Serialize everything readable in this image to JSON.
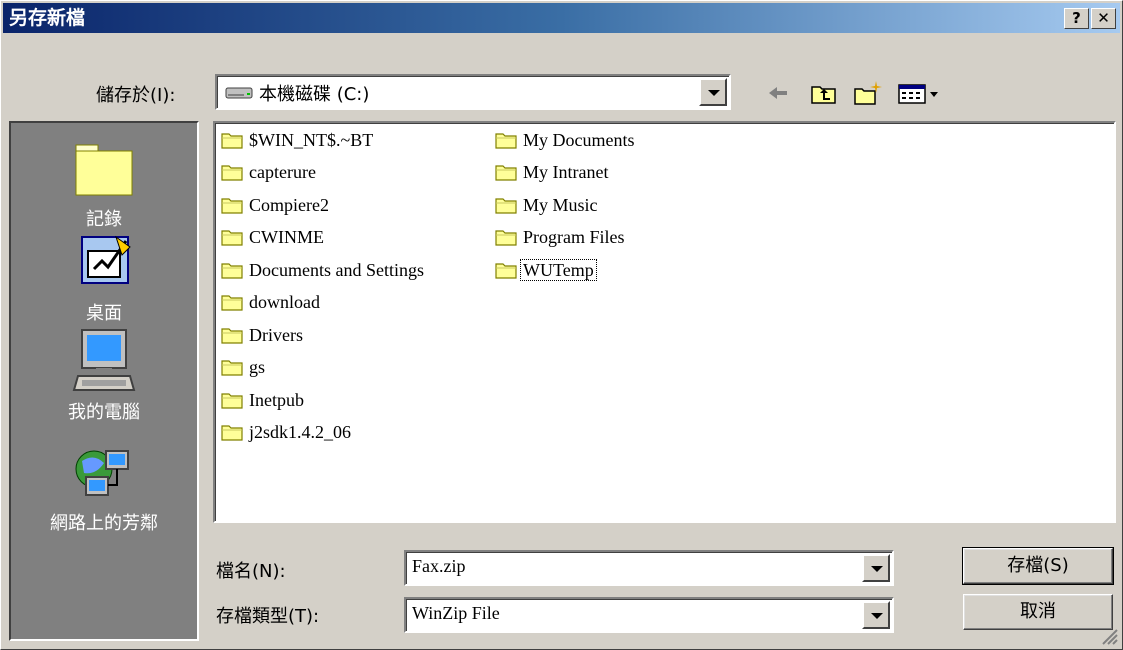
{
  "window": {
    "title": "另存新檔",
    "help_label": "?",
    "close_label": "✕"
  },
  "save_in": {
    "label": "儲存於(I):",
    "value": "本機磁碟 (C:)",
    "icon": "hard-drive-icon"
  },
  "toolbar": {
    "back_icon": "back-arrow-icon",
    "up_icon": "up-folder-icon",
    "new_folder_icon": "new-folder-icon",
    "views_icon": "views-menu-icon"
  },
  "places": [
    {
      "label": "記錄",
      "icon": "history-folder-icon"
    },
    {
      "label": "桌面",
      "icon": "desktop-icon"
    },
    {
      "label": "我的電腦",
      "icon": "my-computer-icon"
    },
    {
      "label": "網路上的芳鄰",
      "icon": "network-places-icon"
    }
  ],
  "files": {
    "col1": [
      "$WIN_NT$.~BT",
      "capterure",
      "Compiere2",
      "CWINME",
      "Documents and Settings",
      "download",
      "Drivers",
      "gs",
      "Inetpub",
      "j2sdk1.4.2_06"
    ],
    "col2": [
      "My Documents",
      "My Intranet",
      "My Music",
      "Program Files",
      "WUTemp"
    ]
  },
  "filename": {
    "label": "檔名(N):",
    "value": "Fax.zip"
  },
  "filetype": {
    "label": "存檔類型(T):",
    "value": "WinZip File"
  },
  "buttons": {
    "save": "存檔(S)",
    "cancel": "取消"
  }
}
